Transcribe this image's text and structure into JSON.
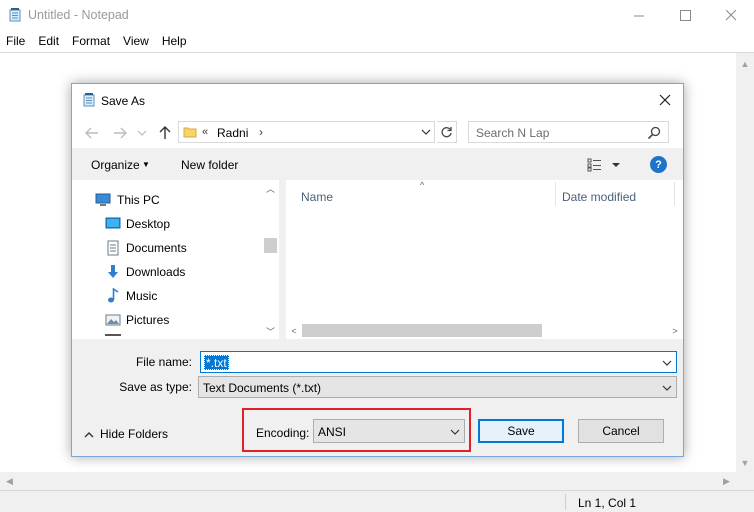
{
  "notepad": {
    "title": "Untitled - Notepad",
    "menu": [
      "File",
      "Edit",
      "Format",
      "View",
      "Help"
    ],
    "status": "Ln 1, Col 1"
  },
  "dialog": {
    "title": "Save As",
    "address": {
      "chevron": "«",
      "folder": "Radni",
      "separator": "›"
    },
    "search": {
      "placeholder": "Search N Lap"
    },
    "toolbar": {
      "organize_label": "Organize",
      "new_folder_label": "New folder"
    },
    "nav_items": [
      {
        "label": "This PC",
        "icon": "pc-icon"
      },
      {
        "label": "Desktop",
        "icon": "desktop-icon"
      },
      {
        "label": "Documents",
        "icon": "documents-icon"
      },
      {
        "label": "Downloads",
        "icon": "downloads-icon"
      },
      {
        "label": "Music",
        "icon": "music-icon"
      },
      {
        "label": "Pictures",
        "icon": "pictures-icon"
      }
    ],
    "columns": {
      "name": "Name",
      "date_modified": "Date modified"
    },
    "file_name": {
      "label": "File name:",
      "value": "*.txt"
    },
    "save_as_type": {
      "label": "Save as type:",
      "value": "Text Documents (*.txt)"
    },
    "hide_folders_label": "Hide Folders",
    "encoding": {
      "label": "Encoding:",
      "value": "ANSI"
    },
    "buttons": {
      "save": "Save",
      "cancel": "Cancel"
    }
  },
  "colors": {
    "accent": "#0078d7",
    "highlight_box": "#e0202b",
    "help_icon": "#1e74c9"
  }
}
